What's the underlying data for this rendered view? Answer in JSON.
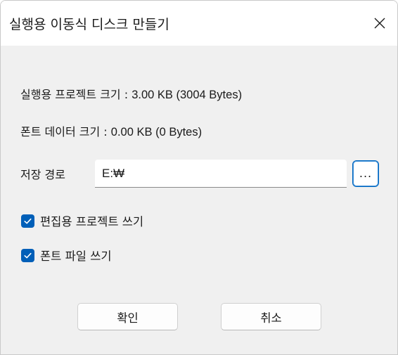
{
  "window": {
    "title": "실행용 이동식 디스크 만들기"
  },
  "info": {
    "project_size_label": "실행용 프로젝트 크기 : ",
    "project_size_value": "3.00 KB (3004 Bytes)",
    "font_size_label": "폰트 데이터 크기 : ",
    "font_size_value": "0.00 KB (0 Bytes)"
  },
  "save_path": {
    "label": "저장 경로",
    "value": "E:₩",
    "browse_label": "..."
  },
  "options": [
    {
      "label": "편집용 프로젝트 쓰기",
      "checked": true
    },
    {
      "label": "폰트 파일 쓰기",
      "checked": true
    }
  ],
  "buttons": {
    "ok": "확인",
    "cancel": "취소"
  },
  "colors": {
    "accent": "#005fb8",
    "dialog_bg": "#f0f0f0",
    "titlebar_bg": "#ffffff"
  },
  "icons": {
    "close": "close-icon",
    "check": "checkmark-icon"
  }
}
